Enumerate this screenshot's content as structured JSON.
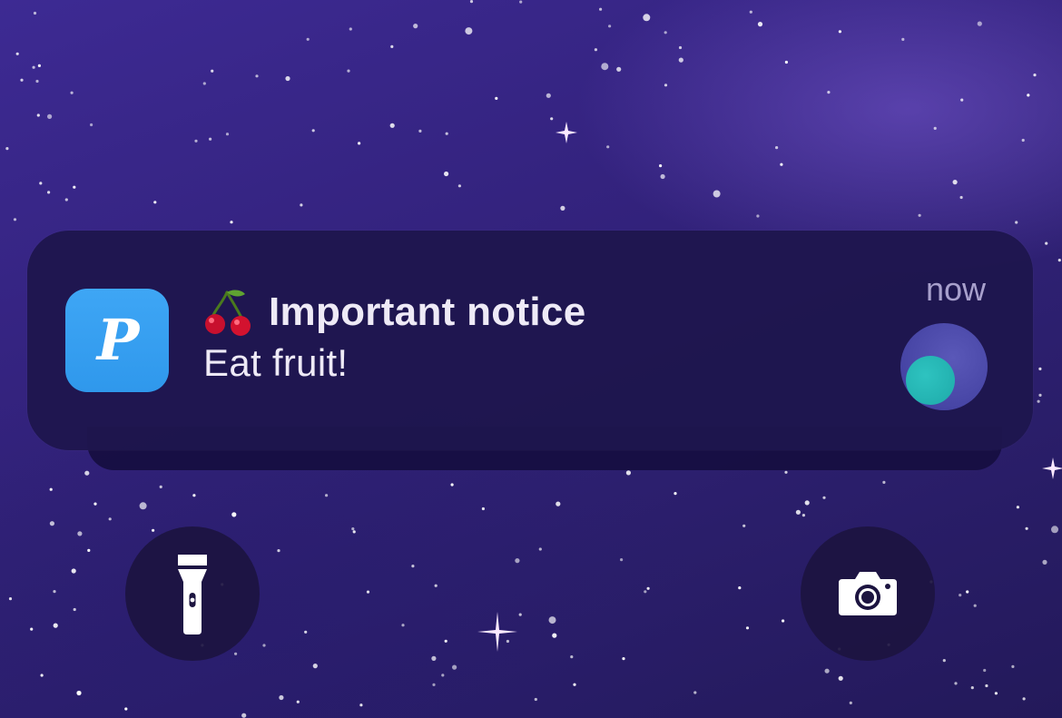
{
  "notification": {
    "app_name_icon": "P",
    "emoji": "🍒",
    "title": "Important notice",
    "body": "Eat fruit!",
    "time": "now"
  },
  "icons": {
    "app": "app-icon",
    "cherry": "cherry-icon",
    "attachment": "attachment-thumbnail",
    "flashlight": "flashlight-icon",
    "camera": "camera-icon"
  },
  "colors": {
    "app_icon": "#3ea6f5",
    "notification_bg": "#1e164e",
    "attachment_outer": "#4644a4",
    "attachment_inner": "#1eaaa9"
  }
}
